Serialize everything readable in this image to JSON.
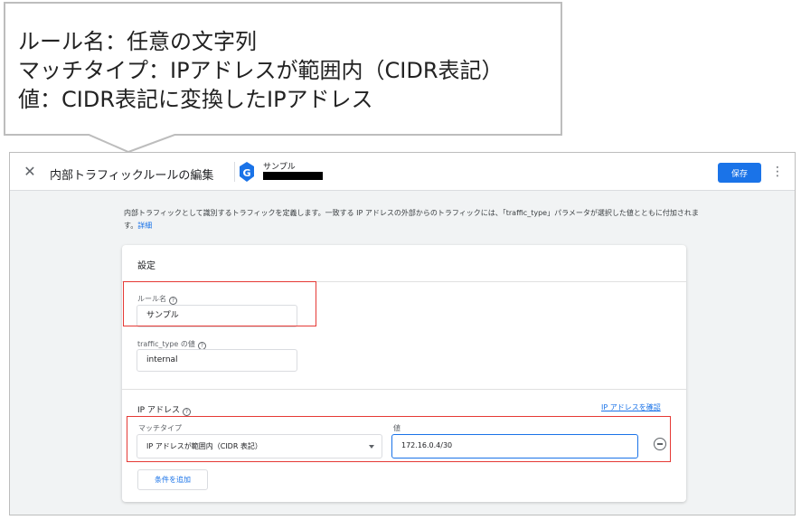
{
  "callout": {
    "line1": "ルール名：任意の文字列",
    "line2": "マッチタイプ：IPアドレスが範囲内（CIDR表記）",
    "line3": "値：CIDR表記に変換したIPアドレス"
  },
  "topbar": {
    "close_glyph": "✕",
    "title": "内部トラフィックルールの編集",
    "property_name": "サンプル",
    "save_label": "保存",
    "more_glyph": "⋮"
  },
  "description": {
    "text": "内部トラフィックとして識別するトラフィックを定義します。一致する IP アドレスの外部からのトラフィックには、「traffic_type」パラメータが選択した値とともに付加されます。",
    "link": "詳細"
  },
  "card": {
    "title": "設定",
    "rule_name": {
      "label": "ルール名",
      "value": "サンプル"
    },
    "traffic_type": {
      "label": "traffic_type の値",
      "value": "internal"
    },
    "ip_section": {
      "title": "IP アドレス",
      "check_link": "IP アドレスを確認",
      "match_type_label": "マッチタイプ",
      "match_type_value": "IP アドレスが範囲内（CIDR 表記）",
      "value_label": "値",
      "value": "172.16.0.4/30",
      "add_condition_label": "条件を追加"
    },
    "help_glyph": "?"
  },
  "colors": {
    "primary": "#1a73e8",
    "highlight": "#e53935",
    "background": "#f1f3f4"
  }
}
